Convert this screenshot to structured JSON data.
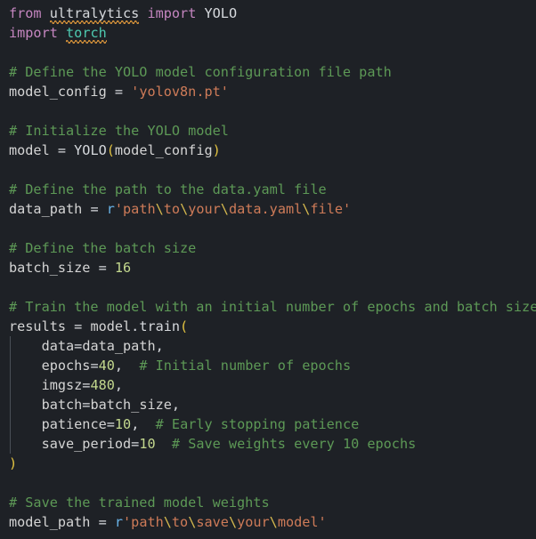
{
  "editor": {
    "background": "#1e2126",
    "language": "python",
    "font_size_px": 15.2,
    "line_height_px": 22,
    "colors": {
      "keyword": "#c586c0",
      "comment": "#5d9956",
      "string": "#ce7b58",
      "escape": "#d7ba4f",
      "variable": "#69b3e8",
      "plain": "#d6d9dd",
      "module": "#4ec9b0",
      "number": "#c3d88e",
      "bracket": "#e4c441",
      "parameter": "#7cc3ec",
      "warning_squiggle": "#d7933a",
      "indent_guide": "#4a4f57"
    }
  },
  "code": {
    "lines": [
      {
        "n": 1,
        "indent_guide": false,
        "text": "from ultralytics import YOLO",
        "tokens": [
          {
            "t": "from",
            "c": "keyword"
          },
          {
            "t": " ",
            "c": "plain"
          },
          {
            "t": "ultralytics",
            "c": "plain",
            "warn": true
          },
          {
            "t": " ",
            "c": "plain"
          },
          {
            "t": "import",
            "c": "keyword"
          },
          {
            "t": " ",
            "c": "plain"
          },
          {
            "t": "YOLO",
            "c": "plain"
          }
        ]
      },
      {
        "n": 2,
        "indent_guide": false,
        "text": "import torch",
        "tokens": [
          {
            "t": "import",
            "c": "keyword"
          },
          {
            "t": " ",
            "c": "plain"
          },
          {
            "t": "torch",
            "c": "module",
            "warn": true
          }
        ]
      },
      {
        "n": 3,
        "indent_guide": false,
        "text": "",
        "tokens": []
      },
      {
        "n": 4,
        "indent_guide": false,
        "text": "# Define the YOLO model configuration file path",
        "tokens": [
          {
            "t": "# Define the YOLO model configuration file path",
            "c": "comment"
          }
        ]
      },
      {
        "n": 5,
        "indent_guide": false,
        "text": "model_config = 'yolov8n.pt'",
        "tokens": [
          {
            "t": "model_config",
            "c": "variable"
          },
          {
            "t": " = ",
            "c": "plain"
          },
          {
            "t": "'yolov8n.pt'",
            "c": "string"
          }
        ]
      },
      {
        "n": 6,
        "indent_guide": false,
        "text": "",
        "tokens": []
      },
      {
        "n": 7,
        "indent_guide": false,
        "text": "# Initialize the YOLO model",
        "tokens": [
          {
            "t": "# Initialize the YOLO model",
            "c": "comment"
          }
        ]
      },
      {
        "n": 8,
        "indent_guide": false,
        "text": "model = YOLO(model_config)",
        "tokens": [
          {
            "t": "model",
            "c": "variable"
          },
          {
            "t": " = ",
            "c": "plain"
          },
          {
            "t": "YOLO",
            "c": "plain"
          },
          {
            "t": "(",
            "c": "bracket"
          },
          {
            "t": "model_config",
            "c": "variable"
          },
          {
            "t": ")",
            "c": "bracket"
          }
        ]
      },
      {
        "n": 9,
        "indent_guide": false,
        "text": "",
        "tokens": []
      },
      {
        "n": 10,
        "indent_guide": false,
        "text": "# Define the path to the data.yaml file",
        "tokens": [
          {
            "t": "# Define the path to the data.yaml file",
            "c": "comment"
          }
        ]
      },
      {
        "n": 11,
        "indent_guide": false,
        "text": "data_path = r'path\\to\\your\\data.yaml\\file'",
        "tokens": [
          {
            "t": "data_path",
            "c": "variable"
          },
          {
            "t": " = ",
            "c": "plain"
          },
          {
            "t": "r",
            "c": "prefix"
          },
          {
            "t": "'path",
            "c": "string"
          },
          {
            "t": "\\",
            "c": "escape"
          },
          {
            "t": "to",
            "c": "string"
          },
          {
            "t": "\\",
            "c": "escape"
          },
          {
            "t": "your",
            "c": "string"
          },
          {
            "t": "\\",
            "c": "escape"
          },
          {
            "t": "data.yaml",
            "c": "string"
          },
          {
            "t": "\\",
            "c": "escape"
          },
          {
            "t": "file'",
            "c": "string"
          }
        ]
      },
      {
        "n": 12,
        "indent_guide": false,
        "text": "",
        "tokens": []
      },
      {
        "n": 13,
        "indent_guide": false,
        "text": "# Define the batch size",
        "tokens": [
          {
            "t": "# Define the batch size",
            "c": "comment"
          }
        ]
      },
      {
        "n": 14,
        "indent_guide": false,
        "text": "batch_size = 16",
        "tokens": [
          {
            "t": "batch_size",
            "c": "variable"
          },
          {
            "t": " = ",
            "c": "plain"
          },
          {
            "t": "16",
            "c": "number"
          }
        ]
      },
      {
        "n": 15,
        "indent_guide": false,
        "text": "",
        "tokens": []
      },
      {
        "n": 16,
        "indent_guide": false,
        "text": "# Train the model with an initial number of epochs and batch size",
        "tokens": [
          {
            "t": "# Train the model with an initial number of epochs and batch size",
            "c": "comment"
          }
        ]
      },
      {
        "n": 17,
        "indent_guide": false,
        "text": "results = model.train(",
        "tokens": [
          {
            "t": "results",
            "c": "variable"
          },
          {
            "t": " = ",
            "c": "plain"
          },
          {
            "t": "model",
            "c": "variable"
          },
          {
            "t": ".",
            "c": "plain"
          },
          {
            "t": "train",
            "c": "plain"
          },
          {
            "t": "(",
            "c": "bracket"
          }
        ]
      },
      {
        "n": 18,
        "indent_guide": true,
        "text": "    data=data_path,",
        "tokens": [
          {
            "t": "    ",
            "c": "plain"
          },
          {
            "t": "data",
            "c": "parameter"
          },
          {
            "t": "=",
            "c": "plain"
          },
          {
            "t": "data_path",
            "c": "variable"
          },
          {
            "t": ",",
            "c": "plain"
          }
        ]
      },
      {
        "n": 19,
        "indent_guide": true,
        "text": "    epochs=40,  # Initial number of epochs",
        "tokens": [
          {
            "t": "    ",
            "c": "plain"
          },
          {
            "t": "epochs",
            "c": "parameter"
          },
          {
            "t": "=",
            "c": "plain"
          },
          {
            "t": "40",
            "c": "number"
          },
          {
            "t": ",",
            "c": "plain"
          },
          {
            "t": "  ",
            "c": "plain"
          },
          {
            "t": "# Initial number of epochs",
            "c": "comment"
          }
        ]
      },
      {
        "n": 20,
        "indent_guide": true,
        "text": "    imgsz=480,",
        "tokens": [
          {
            "t": "    ",
            "c": "plain"
          },
          {
            "t": "imgsz",
            "c": "parameter"
          },
          {
            "t": "=",
            "c": "plain"
          },
          {
            "t": "480",
            "c": "number"
          },
          {
            "t": ",",
            "c": "plain"
          }
        ]
      },
      {
        "n": 21,
        "indent_guide": true,
        "text": "    batch=batch_size,",
        "tokens": [
          {
            "t": "    ",
            "c": "plain"
          },
          {
            "t": "batch",
            "c": "parameter"
          },
          {
            "t": "=",
            "c": "plain"
          },
          {
            "t": "batch_size",
            "c": "variable"
          },
          {
            "t": ",",
            "c": "plain"
          }
        ]
      },
      {
        "n": 22,
        "indent_guide": true,
        "text": "    patience=10,  # Early stopping patience",
        "tokens": [
          {
            "t": "    ",
            "c": "plain"
          },
          {
            "t": "patience",
            "c": "parameter"
          },
          {
            "t": "=",
            "c": "plain"
          },
          {
            "t": "10",
            "c": "number"
          },
          {
            "t": ",",
            "c": "plain"
          },
          {
            "t": "  ",
            "c": "plain"
          },
          {
            "t": "# Early stopping patience",
            "c": "comment"
          }
        ]
      },
      {
        "n": 23,
        "indent_guide": true,
        "text": "    save_period=10  # Save weights every 10 epochs",
        "tokens": [
          {
            "t": "    ",
            "c": "plain"
          },
          {
            "t": "save_period",
            "c": "parameter"
          },
          {
            "t": "=",
            "c": "plain"
          },
          {
            "t": "10",
            "c": "number"
          },
          {
            "t": "  ",
            "c": "plain"
          },
          {
            "t": "# Save weights every 10 epochs",
            "c": "comment"
          }
        ]
      },
      {
        "n": 24,
        "indent_guide": false,
        "text": ")",
        "tokens": [
          {
            "t": ")",
            "c": "bracket"
          }
        ]
      },
      {
        "n": 25,
        "indent_guide": false,
        "text": "",
        "tokens": []
      },
      {
        "n": 26,
        "indent_guide": false,
        "text": "# Save the trained model weights",
        "tokens": [
          {
            "t": "# Save the trained model weights",
            "c": "comment"
          }
        ]
      },
      {
        "n": 27,
        "indent_guide": false,
        "text": "model_path = r'path\\to\\save\\your\\model'",
        "tokens": [
          {
            "t": "model_path",
            "c": "variable"
          },
          {
            "t": " = ",
            "c": "plain"
          },
          {
            "t": "r",
            "c": "prefix"
          },
          {
            "t": "'path",
            "c": "string"
          },
          {
            "t": "\\",
            "c": "escape"
          },
          {
            "t": "to",
            "c": "string"
          },
          {
            "t": "\\",
            "c": "escape"
          },
          {
            "t": "save",
            "c": "string"
          },
          {
            "t": "\\",
            "c": "escape"
          },
          {
            "t": "your",
            "c": "string"
          },
          {
            "t": "\\",
            "c": "escape"
          },
          {
            "t": "model'",
            "c": "string"
          }
        ]
      }
    ]
  }
}
